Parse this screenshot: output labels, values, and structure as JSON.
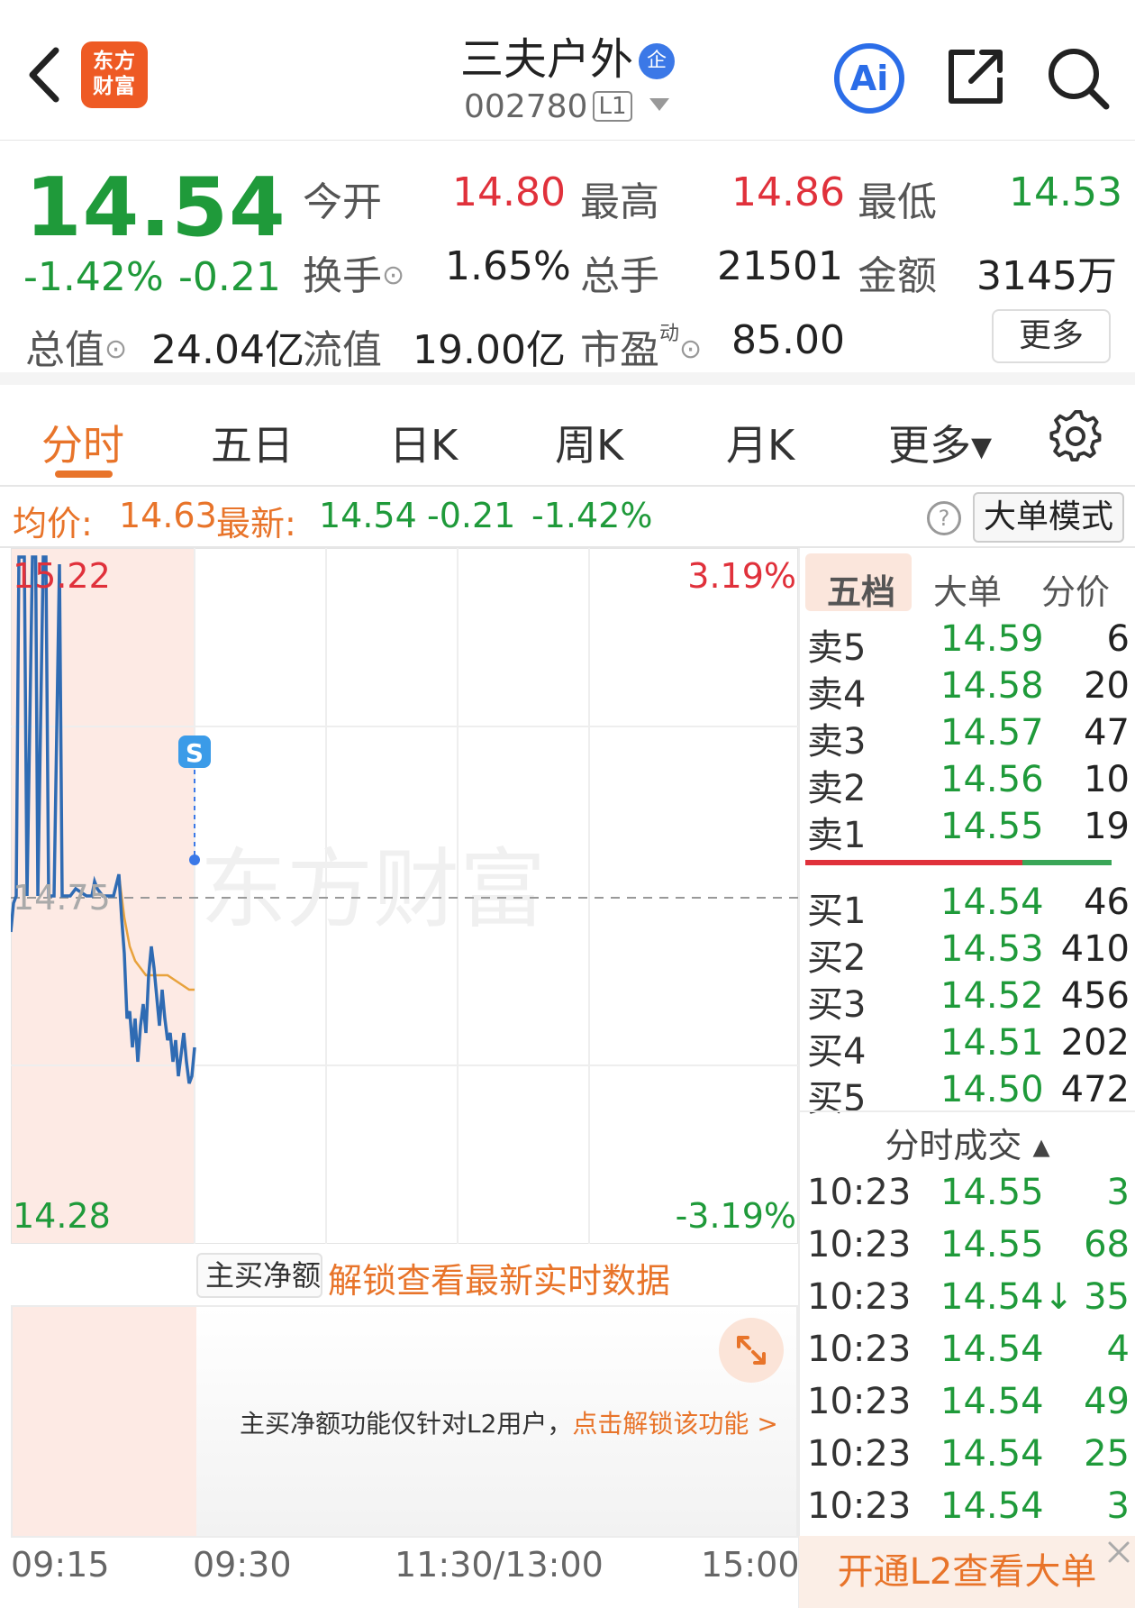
{
  "header": {
    "back_icon": "chevron-left-icon",
    "logo_line1": "东方",
    "logo_line2": "财富",
    "title": "三夫户外",
    "title_badge": "企",
    "code": "002780",
    "level": "L1",
    "ai_label": "Ai",
    "share_icon": "share-icon",
    "search_icon": "search-icon"
  },
  "quote": {
    "price": "14.54",
    "change_pct": "-1.42%",
    "change": "-0.21",
    "open_label": "今开",
    "open": "14.80",
    "high_label": "最高",
    "high": "14.86",
    "low_label": "最低",
    "low": "14.53",
    "turnover_label": "换手",
    "turnover": "1.65%",
    "volume_label": "总手",
    "volume": "21501",
    "amount_label": "金额",
    "amount": "3145万",
    "total_cap_label": "总值",
    "total_cap": "24.04亿",
    "float_cap_label": "流值",
    "float_cap": "19.00亿",
    "pe_label": "市盈",
    "pe_sup": "动",
    "pe": "85.00",
    "more_button": "更多"
  },
  "tabs": [
    "分时",
    "五日",
    "日K",
    "周K",
    "月K",
    "更多▾"
  ],
  "info_line": {
    "avg_label": "均价:",
    "avg": "14.63",
    "latest_label": "最新:",
    "latest": "14.54",
    "change": "-0.21",
    "change_pct": "-1.42%",
    "big_order_button": "大单模式"
  },
  "chart_data": {
    "type": "line",
    "y_top_label": "15.22",
    "y_mid_label": "14.75",
    "y_bottom_label": "14.28",
    "pct_top_label": "3.19%",
    "pct_bottom_label": "-3.19%",
    "x_labels": [
      "09:15",
      "09:30",
      "11:30/13:00",
      "15:00"
    ],
    "ylim": [
      14.28,
      15.22
    ],
    "prev_close": 14.75,
    "marker": "S",
    "watermark": "东方财富",
    "series": [
      {
        "name": "price",
        "color": "#2f6bb3",
        "points": [
          [
            0,
            14.7
          ],
          [
            0.5,
            14.74
          ],
          [
            1,
            14.75
          ],
          [
            1.5,
            15.22
          ],
          [
            2.5,
            15.22
          ],
          [
            3,
            14.75
          ],
          [
            4,
            15.22
          ],
          [
            4.6,
            15.22
          ],
          [
            5,
            14.75
          ],
          [
            6,
            15.22
          ],
          [
            6.5,
            15.22
          ],
          [
            7,
            14.75
          ],
          [
            8,
            14.75
          ],
          [
            9,
            15.21
          ],
          [
            9.5,
            14.75
          ],
          [
            11,
            14.75
          ],
          [
            12,
            14.76
          ],
          [
            14,
            14.75
          ],
          [
            15,
            14.75
          ],
          [
            15.5,
            14.77
          ],
          [
            16,
            14.76
          ],
          [
            17,
            14.75
          ],
          [
            18,
            14.75
          ],
          [
            19,
            14.75
          ],
          [
            20,
            14.78
          ],
          [
            20.5,
            14.72
          ],
          [
            21,
            14.67
          ],
          [
            21.5,
            14.58
          ],
          [
            22,
            14.59
          ],
          [
            22.5,
            14.54
          ],
          [
            23,
            14.58
          ],
          [
            23.5,
            14.52
          ],
          [
            24,
            14.57
          ],
          [
            24.5,
            14.6
          ],
          [
            25,
            14.56
          ],
          [
            25.5,
            14.64
          ],
          [
            26,
            14.68
          ],
          [
            26.5,
            14.65
          ],
          [
            27,
            14.61
          ],
          [
            27.5,
            14.57
          ],
          [
            28,
            14.62
          ],
          [
            28.5,
            14.58
          ],
          [
            29,
            14.55
          ],
          [
            29.5,
            14.56
          ],
          [
            30,
            14.52
          ],
          [
            30.5,
            14.55
          ],
          [
            31,
            14.5
          ],
          [
            31.5,
            14.53
          ],
          [
            32,
            14.56
          ],
          [
            32.5,
            14.52
          ],
          [
            33,
            14.49
          ],
          [
            33.5,
            14.5
          ],
          [
            34,
            14.54
          ]
        ]
      },
      {
        "name": "avg",
        "color": "#e8a23c",
        "points": [
          [
            20,
            14.78
          ],
          [
            21,
            14.72
          ],
          [
            22,
            14.68
          ],
          [
            23,
            14.66
          ],
          [
            25,
            14.64
          ],
          [
            27,
            14.64
          ],
          [
            29,
            14.64
          ],
          [
            31,
            14.63
          ],
          [
            33,
            14.62
          ],
          [
            34,
            14.62
          ]
        ]
      }
    ]
  },
  "netflow": {
    "selector": "主买净额",
    "unlock_text": "解锁查看最新实时数据",
    "desc": "主买净额功能仅针对L2用户，",
    "desc_link": "点击解锁该功能 >"
  },
  "orderbook": {
    "tabs": [
      "五档",
      "大单",
      "分价"
    ],
    "sell": [
      {
        "label": "卖5",
        "price": "14.59",
        "vol": "6"
      },
      {
        "label": "卖4",
        "price": "14.58",
        "vol": "20"
      },
      {
        "label": "卖3",
        "price": "14.57",
        "vol": "47"
      },
      {
        "label": "卖2",
        "price": "14.56",
        "vol": "10"
      },
      {
        "label": "卖1",
        "price": "14.55",
        "vol": "19"
      }
    ],
    "buy": [
      {
        "label": "买1",
        "price": "14.54",
        "vol": "46"
      },
      {
        "label": "买2",
        "price": "14.53",
        "vol": "410"
      },
      {
        "label": "买3",
        "price": "14.52",
        "vol": "456"
      },
      {
        "label": "买4",
        "price": "14.51",
        "vol": "202"
      },
      {
        "label": "买5",
        "price": "14.50",
        "vol": "472"
      }
    ],
    "ratio_sell": 0.71
  },
  "ticks": {
    "title": "分时成交 ▴",
    "rows": [
      {
        "time": "10:23",
        "price": "14.55",
        "vol": "3"
      },
      {
        "time": "10:23",
        "price": "14.55",
        "vol": "68"
      },
      {
        "time": "10:23",
        "price": "14.54↓",
        "vol": "35"
      },
      {
        "time": "10:23",
        "price": "14.54",
        "vol": "4"
      },
      {
        "time": "10:23",
        "price": "14.54",
        "vol": "49"
      },
      {
        "time": "10:23",
        "price": "14.54",
        "vol": "25"
      },
      {
        "time": "10:23",
        "price": "14.54",
        "vol": "3"
      }
    ],
    "l2_button": "开通L2查看大单"
  }
}
